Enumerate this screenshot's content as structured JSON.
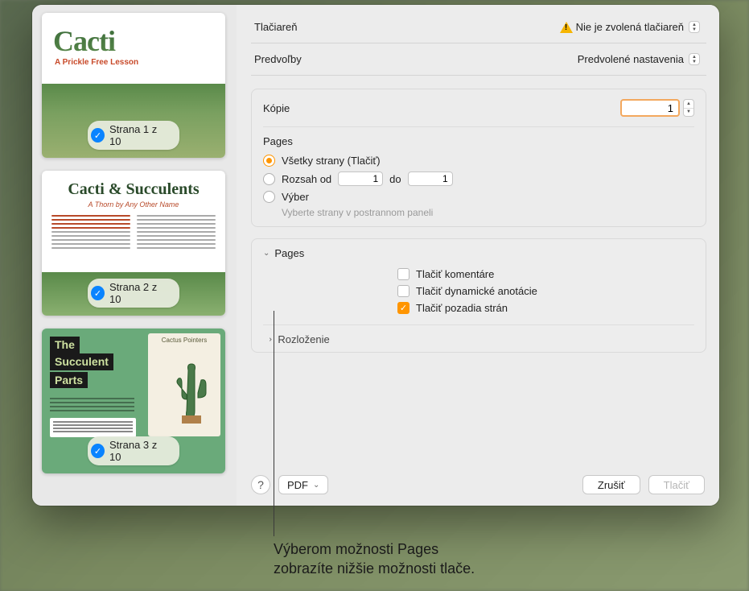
{
  "sidebar": {
    "pages": [
      {
        "badge": "Strana 1 z 10",
        "title": "Cacti",
        "subtitle": "A Prickle Free Lesson"
      },
      {
        "badge": "Strana 2 z 10",
        "title": "Cacti & Succulents",
        "subtitle": "A Thorn by Any Other Name"
      },
      {
        "badge": "Strana 3 z 10",
        "title1": "The",
        "title2": "Succulent",
        "title3": "Parts",
        "right_title": "Cactus Pointers"
      }
    ]
  },
  "printer": {
    "label": "Tlačiareň",
    "value": "Nie je zvolená tlačiareň"
  },
  "presets": {
    "label": "Predvoľby",
    "value": "Predvolené nastavenia"
  },
  "copies": {
    "label": "Kópie",
    "value": "1"
  },
  "pages_section": {
    "heading": "Pages",
    "options": {
      "all": {
        "label": "Všetky strany (Tlačiť)"
      },
      "range": {
        "label_from": "Rozsah od",
        "from": "1",
        "label_to": "do",
        "to": "1"
      },
      "selection": {
        "label": "Výber",
        "hint": "Vyberte strany v postrannom paneli"
      }
    }
  },
  "app_options": {
    "heading": "Pages",
    "print_comments": "Tlačiť komentáre",
    "print_annotations": "Tlačiť dynamické anotácie",
    "print_backgrounds": "Tlačiť pozadia strán"
  },
  "layout_section": {
    "heading": "Rozloženie"
  },
  "toolbar": {
    "pdf": "PDF",
    "cancel": "Zrušiť",
    "print": "Tlačiť"
  },
  "callout": {
    "line1": "Výberom možnosti Pages",
    "line2": "zobrazíte nižšie možnosti tlače."
  }
}
